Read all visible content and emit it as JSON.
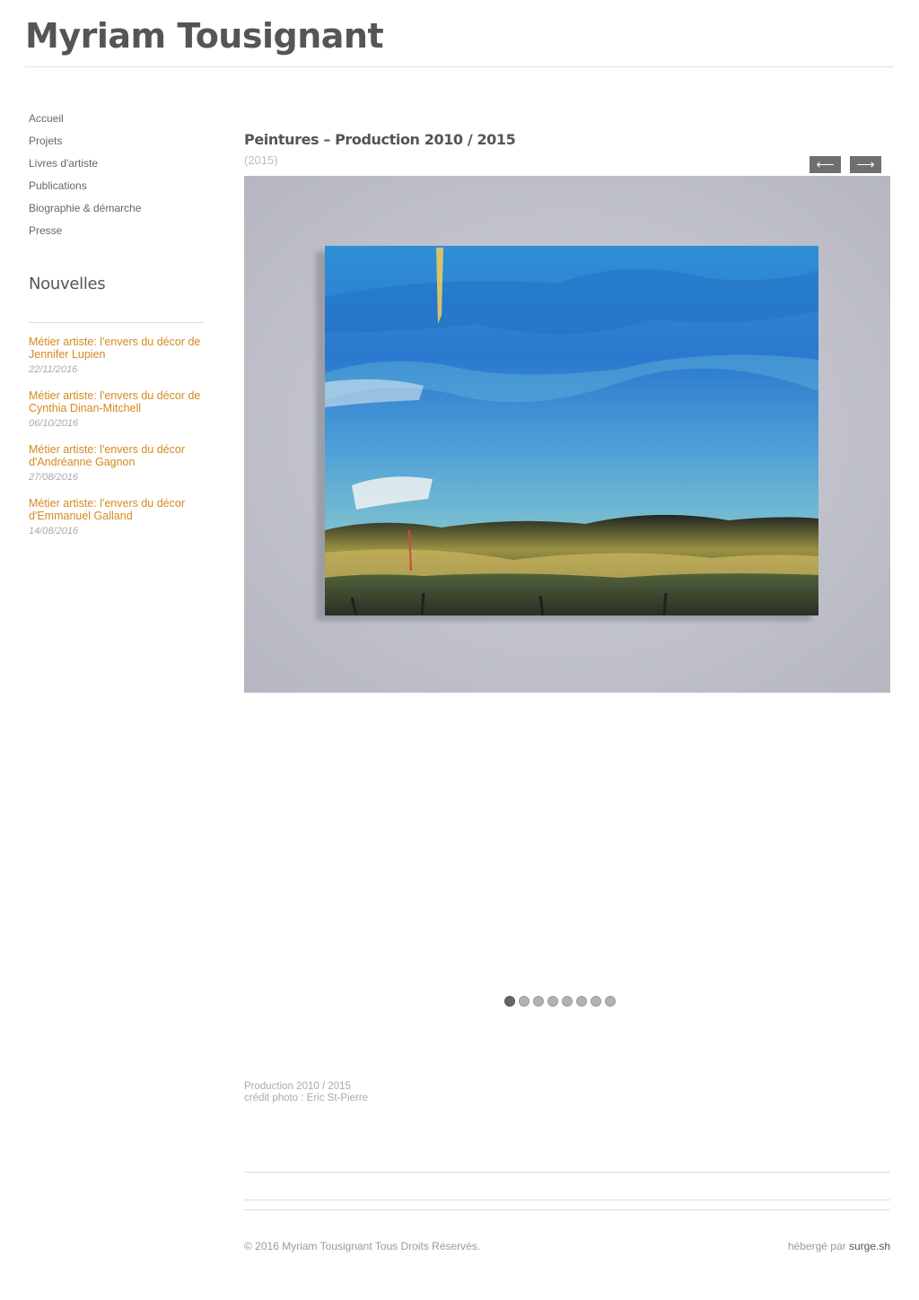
{
  "site": {
    "title": "Myriam Tousignant"
  },
  "nav": {
    "items": [
      {
        "label": "Accueil"
      },
      {
        "label": "Projets"
      },
      {
        "label": "Livres d'artiste"
      },
      {
        "label": "Publications"
      },
      {
        "label": "Biographie & démarche"
      },
      {
        "label": "Presse"
      }
    ]
  },
  "news": {
    "heading": "Nouvelles",
    "items": [
      {
        "title": "Métier artiste: l'envers du décor de Jennifer Lupien",
        "date": "22/11/2016"
      },
      {
        "title": "Métier artiste: l'envers du décor de Cynthia Dinan-Mitchell",
        "date": "06/10/2016"
      },
      {
        "title": "Métier artiste: l'envers du décor d'Andréanne Gagnon",
        "date": "27/08/2016"
      },
      {
        "title": "Métier artiste: l'envers du décor d'Emmanuel Galland",
        "date": "14/08/2016"
      }
    ]
  },
  "post": {
    "title": "Peintures – Production 2010 / 2015",
    "year": "(2015)",
    "prev_icon": "left-arrow-icon",
    "next_icon": "right-arrow-icon",
    "prev_glyph": "⟵",
    "next_glyph": "⟶",
    "slideshow": {
      "total_slides": 8,
      "current_slide": 1
    },
    "caption": {
      "line1": "Production 2010 / 2015",
      "line2": "crédit photo : Eric St-Pierre"
    }
  },
  "footer": {
    "copyright": "© 2016 Myriam Tousignant Tous Droits Réservés.",
    "hosted_prefix": "hébergé par",
    "hosted_link": "surge.sh"
  },
  "colors": {
    "accent_link": "#d48a1e",
    "text": "#555555",
    "button_bg": "#6f6f6f"
  }
}
